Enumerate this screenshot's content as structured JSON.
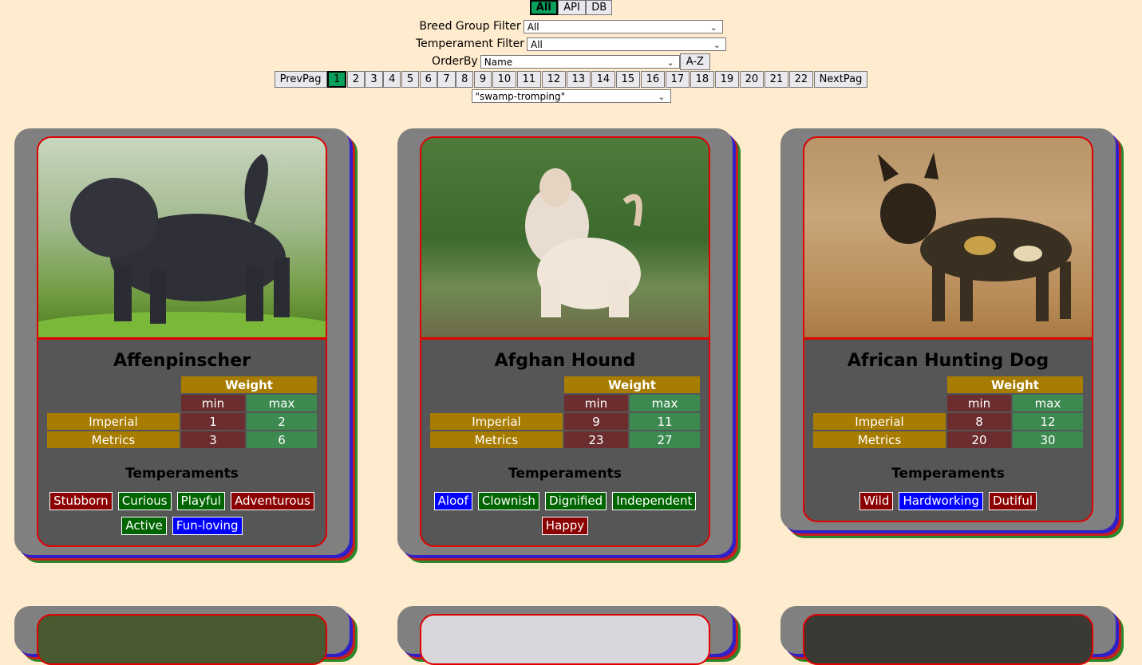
{
  "source_buttons": [
    "All",
    "API",
    "DB"
  ],
  "filters": {
    "breed_group_label": "Breed Group Filter",
    "breed_group_value": "All",
    "temperament_label": "Temperament Filter",
    "temperament_value": "All",
    "orderby_label": "OrderBy",
    "orderby_value": "Name",
    "order_dir": "A-Z"
  },
  "pager": {
    "prev": "PrevPag",
    "next": "NextPag",
    "pages": [
      "1",
      "2",
      "3",
      "4",
      "5",
      "6",
      "7",
      "8",
      "9",
      "10",
      "11",
      "12",
      "13",
      "14",
      "15",
      "16",
      "17",
      "18",
      "19",
      "20",
      "21",
      "22"
    ],
    "active": "1"
  },
  "extra_select": "\"swamp-tromping\"",
  "cards": [
    {
      "name": "Affenpinscher",
      "weight_title": "Weight",
      "min": "min",
      "max": "max",
      "imperial_label": "Imperial",
      "imperial_min": "1",
      "imperial_max": "2",
      "metric_label": "Metrics",
      "metric_min": "3",
      "metric_max": "6",
      "temps_title": "Temperaments",
      "tags": [
        "Stubborn",
        "Curious",
        "Playful",
        "Adventurous",
        "Active",
        "Fun-loving"
      ]
    },
    {
      "name": "Afghan Hound",
      "weight_title": "Weight",
      "min": "min",
      "max": "max",
      "imperial_label": "Imperial",
      "imperial_min": "9",
      "imperial_max": "11",
      "metric_label": "Metrics",
      "metric_min": "23",
      "metric_max": "27",
      "temps_title": "Temperaments",
      "tags": [
        "Aloof",
        "Clownish",
        "Dignified",
        "Independent",
        "Happy"
      ]
    },
    {
      "name": "African Hunting Dog",
      "weight_title": "Weight",
      "min": "min",
      "max": "max",
      "imperial_label": "Imperial",
      "imperial_min": "8",
      "imperial_max": "12",
      "metric_label": "Metrics",
      "metric_min": "20",
      "metric_max": "30",
      "temps_title": "Temperaments",
      "tags": [
        "Wild",
        "Hardworking",
        "Dutiful"
      ]
    }
  ],
  "colors": {
    "background": "#ffebcd",
    "active": "#08a05a",
    "card": "#808080",
    "border": "#e00000"
  }
}
